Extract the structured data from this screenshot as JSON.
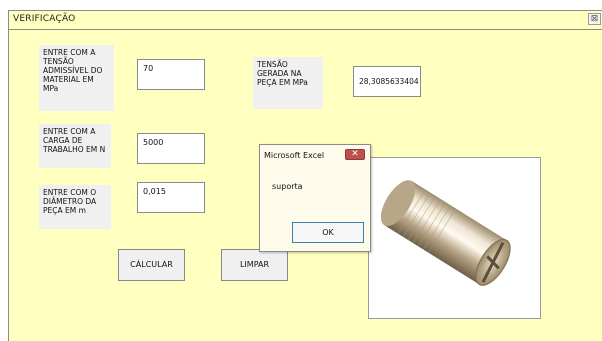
{
  "form": {
    "title": "VERIFICAÇÃO",
    "close_glyph": "⊠"
  },
  "fields": {
    "tensao_admissivel": {
      "label": "ENTRE COM A TENSÃO ADMISSÍVEL DO MATERIAL EM MPa",
      "value": "70"
    },
    "carga": {
      "label": "ENTRE COM A CARGA DE TRABALHO EM  N",
      "value": "5000"
    },
    "diametro": {
      "label": "ENTRE COM O DIÂMETRO DA PEÇA EM m",
      "value": "0,015"
    },
    "tensao_gerada": {
      "label": "TENSÃO GERADA NA PEÇA EM MPa",
      "value": "28,3085633404"
    }
  },
  "buttons": {
    "calcular": "CÁLCULAR",
    "limpar": "LIMPAR"
  },
  "dialog": {
    "title": "Microsoft Excel",
    "close_glyph": "✕",
    "message": "suporta",
    "ok": "OK"
  },
  "image": {
    "icon": "metal-pin-image"
  }
}
